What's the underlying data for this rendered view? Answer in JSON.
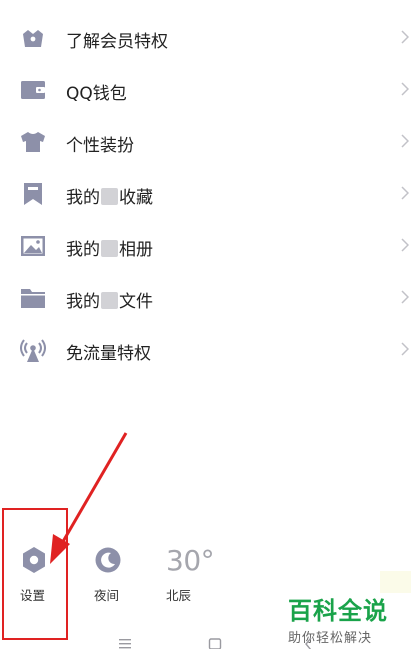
{
  "menu": {
    "items": [
      {
        "label": "了解会员特权"
      },
      {
        "label": "QQ钱包"
      },
      {
        "label": "个性装扮"
      },
      {
        "label_pre": "我的",
        "label_post": "收藏"
      },
      {
        "label_pre": "我的",
        "label_post": "相册"
      },
      {
        "label_pre": "我的",
        "label_post": "文件"
      },
      {
        "label": "免流量特权"
      }
    ]
  },
  "quick_actions": {
    "settings_label": "设置",
    "night_label": "夜间",
    "weather_temp": "30°",
    "weather_city": "北辰"
  },
  "watermark": {
    "title": "百科全说",
    "subtitle": "助你轻松解决"
  },
  "colors": {
    "icon": "#8d90a9",
    "chevron": "#c2c2c8",
    "annotation": "#e02222",
    "watermark": "#1aa34a"
  }
}
